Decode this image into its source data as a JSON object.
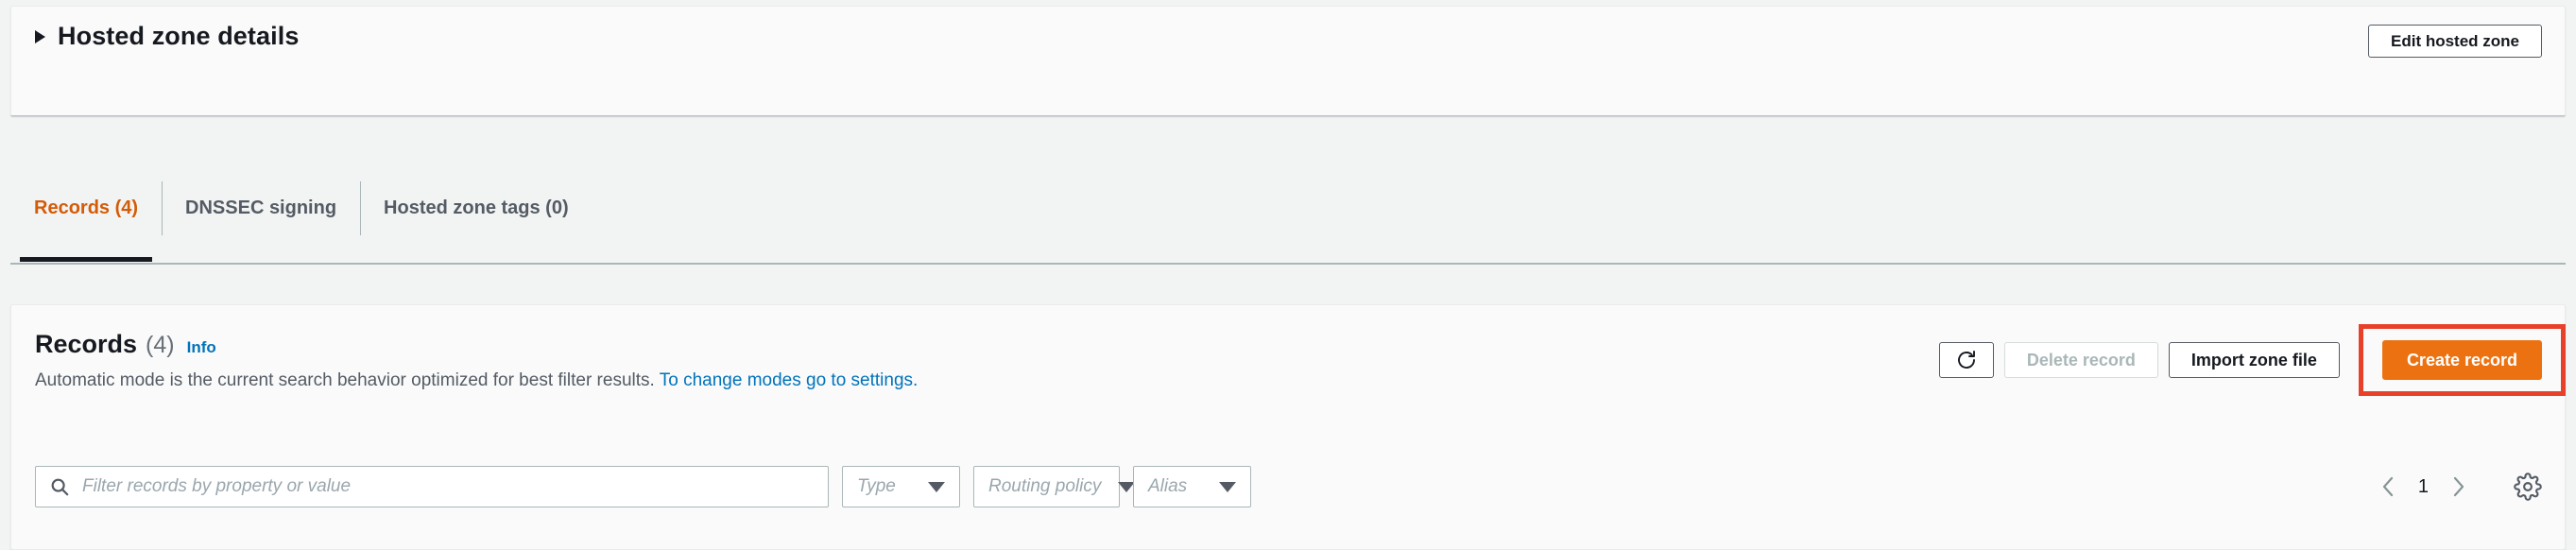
{
  "hosted_zone_panel": {
    "title": "Hosted zone details",
    "expander_icon": "caret-right-icon",
    "expanded": false,
    "edit_button": "Edit hosted zone"
  },
  "tabs": [
    {
      "label": "Records (4)",
      "active": true
    },
    {
      "label": "DNSSEC signing",
      "active": false
    },
    {
      "label": "Hosted zone tags (0)",
      "active": false
    }
  ],
  "records": {
    "title": "Records",
    "count": "(4)",
    "info_link": "Info",
    "description_prefix": "Automatic mode is the current search behavior optimized for best filter results. ",
    "description_link": "To change modes go to settings.",
    "actions": {
      "refresh_icon": "refresh-icon",
      "delete_label": "Delete record",
      "delete_disabled": true,
      "import_label": "Import zone file",
      "create_label": "Create record"
    },
    "filters": {
      "search_icon": "search-icon",
      "search_placeholder": "Filter records by property or value",
      "search_value": "",
      "type_label": "Type",
      "routing_policy_label": "Routing policy",
      "alias_label": "Alias"
    },
    "pagination": {
      "prev_icon": "chevron-left-icon",
      "page": "1",
      "next_icon": "chevron-right-icon",
      "settings_icon": "gear-icon"
    }
  },
  "colors": {
    "accent_orange": "#ec7211",
    "active_tab_orange": "#d45b07",
    "link_blue": "#0073bb",
    "highlight_red": "#e8412a",
    "text_dark": "#16191f",
    "text_muted": "#545b64"
  }
}
